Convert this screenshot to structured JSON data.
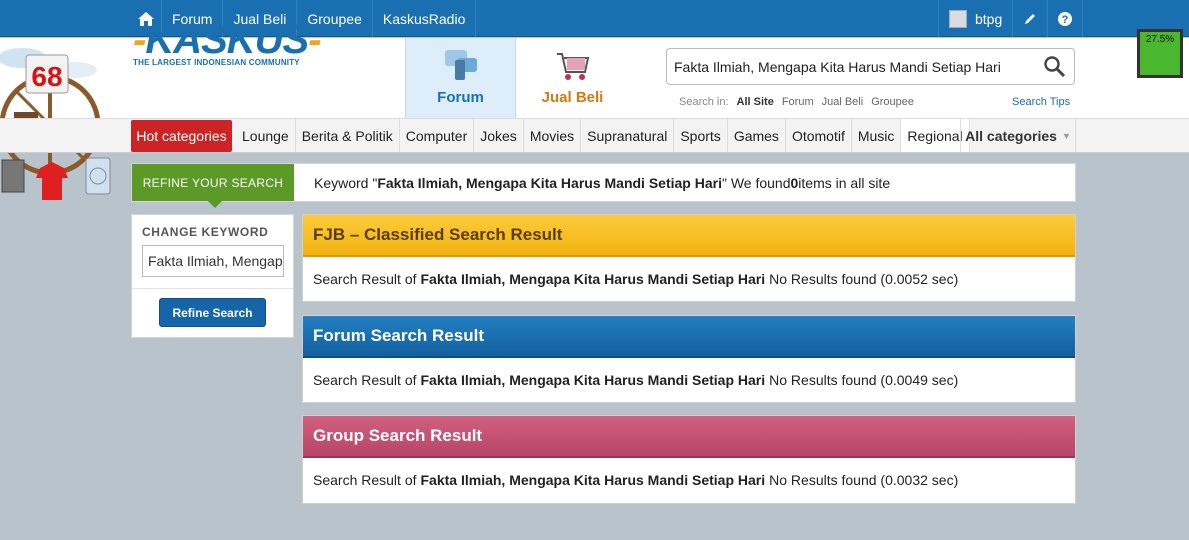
{
  "topbar": {
    "links": [
      "Forum",
      "Jual Beli",
      "Groupee",
      "KaskusRadio"
    ],
    "username": "btpg"
  },
  "battery": {
    "label": "27.5%",
    "color": "#4bb72e"
  },
  "header": {
    "logo_text": "KASKUS",
    "logo_tagline": "THE LARGEST INDONESIAN COMMUNITY",
    "tab_forum": "Forum",
    "tab_jualbeli": "Jual Beli",
    "search_value": "Fakta Ilmiah, Mengapa Kita Harus Mandi Setiap Hari",
    "search_in_label": "Search in:",
    "search_in_options": [
      "All Site",
      "Forum",
      "Jual Beli",
      "Groupee"
    ],
    "search_tips": "Search Tips"
  },
  "decor": {
    "badge": "68"
  },
  "categories": {
    "hot": "Hot categories",
    "items": [
      "Lounge",
      "Berita & Politik",
      "Computer",
      "Jokes",
      "Movies",
      "Supranatural",
      "Sports",
      "Games",
      "Otomotif",
      "Music",
      "Regional"
    ],
    "all": "All categories"
  },
  "refine": {
    "tag": "REFINE YOUR SEARCH",
    "msg_prefix": "Keyword \"",
    "keyword": "Fakta Ilmiah, Mengapa Kita Harus Mandi Setiap Hari",
    "msg_mid": "\" We found ",
    "count": "0",
    "msg_suffix": " items in all site"
  },
  "change_keyword": {
    "title": "CHANGE KEYWORD",
    "value": "Fakta Ilmiah, Mengapa Kita Harus Mandi Setiap Hari",
    "button": "Refine Search"
  },
  "results": [
    {
      "title": "FJB – Classified Search Result",
      "prefix": "Search Result of",
      "keyword": "Fakta Ilmiah, Mengapa Kita Harus Mandi Setiap Hari",
      "status": " No Results found (0.0052 sec)",
      "color": "#f2b311"
    },
    {
      "title": "Forum Search Result",
      "prefix": "Search Result of",
      "keyword": "Fakta Ilmiah, Mengapa Kita Harus Mandi Setiap Hari",
      "status": "No Results found (0.0049 sec)",
      "color": "#13609e"
    },
    {
      "title": "Group Search Result",
      "prefix": "Search Result of",
      "keyword": "Fakta Ilmiah, Mengapa Kita Harus Mandi Setiap Hari",
      "status": "No Results found (0.0032 sec)",
      "color": "#b8456a"
    }
  ]
}
